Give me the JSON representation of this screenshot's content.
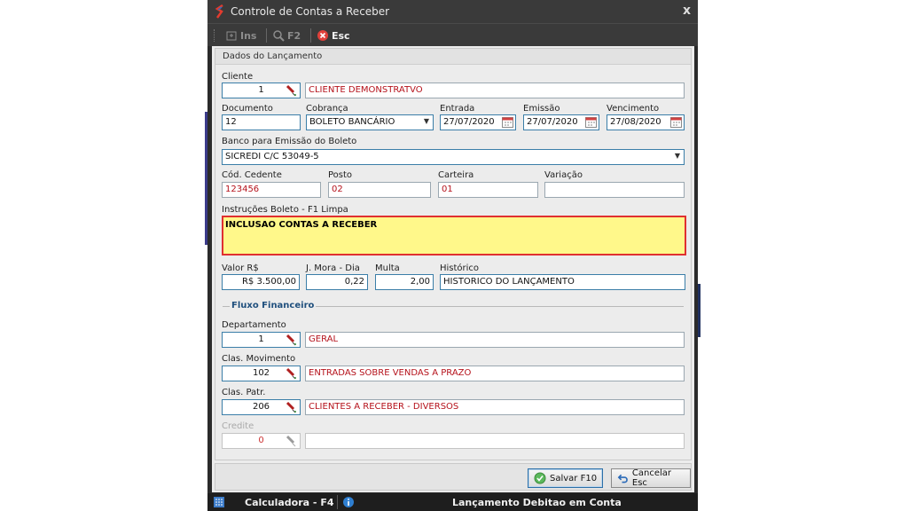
{
  "window": {
    "title": "Controle de Contas a Receber",
    "close_glyph": "x"
  },
  "toolbar": {
    "ins_label": "Ins",
    "f2_label": "F2",
    "esc_label": "Esc"
  },
  "group": {
    "title": "Dados do Lançamento"
  },
  "cliente": {
    "label": "Cliente",
    "code": "1",
    "name": "CLIENTE DEMONSTRATVO"
  },
  "documento": {
    "label": "Documento",
    "value": "12"
  },
  "cobranca": {
    "label": "Cobrança",
    "value": "BOLETO BANCÁRIO"
  },
  "entrada": {
    "label": "Entrada",
    "value": "27/07/2020"
  },
  "emissao": {
    "label": "Emissão",
    "value": "27/07/2020"
  },
  "vencimento": {
    "label": "Vencimento",
    "value": "27/08/2020"
  },
  "banco": {
    "label": "Banco para Emissão do Boleto",
    "value": "SICREDI C/C 53049-5"
  },
  "cedente": {
    "label": "Cód. Cedente",
    "value": "123456"
  },
  "posto": {
    "label": "Posto",
    "value": "02"
  },
  "carteira": {
    "label": "Carteira",
    "value": "01"
  },
  "variacao": {
    "label": "Variação",
    "value": ""
  },
  "instrucoes": {
    "label": "Instruções Boleto - F1 Limpa",
    "value": "INCLUSAO CONTAS A RECEBER"
  },
  "valor": {
    "label": "Valor R$",
    "value": "R$ 3.500,00"
  },
  "mora": {
    "label": "J. Mora - Dia",
    "value": "0,22"
  },
  "multa": {
    "label": "Multa",
    "value": "2,00"
  },
  "historico": {
    "label": "Histórico",
    "value": "HISTORICO DO LANÇAMENTO"
  },
  "fluxo": {
    "title": "Fluxo Financeiro"
  },
  "departamento": {
    "label": "Departamento",
    "code": "1",
    "name": "GERAL"
  },
  "clas_mov": {
    "label": "Clas. Movimento",
    "code": "102",
    "name": "ENTRADAS SOBRE VENDAS A PRAZO"
  },
  "clas_patr": {
    "label": "Clas. Patr.",
    "code": "206",
    "name": "CLIENTES A RECEBER - DIVERSOS"
  },
  "credite": {
    "label": "Credite",
    "code": "0",
    "name": ""
  },
  "buttons": {
    "save": "Salvar F10",
    "cancel": "Cancelar Esc"
  },
  "status": {
    "calc": "Calculadora - F4",
    "info": "Lançamento Debitao em Conta"
  },
  "colors": {
    "error_text": "#b5121b",
    "memo_bg": "#fff88a",
    "memo_border": "#e03030",
    "section_title": "#1f4f7d"
  }
}
